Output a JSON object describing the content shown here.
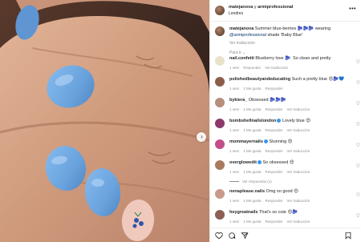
{
  "post": {
    "owner": "matejanova",
    "separator": " y ",
    "coauthor": "armiprofessional",
    "location": "Londres",
    "more_icon": "more-horizontal-icon"
  },
  "caption": {
    "username": "matejanova",
    "text_before": " Summer blue-berries 🫐🫐🫐 wearing ",
    "mention": "@armiprofessional",
    "text_after": " shade 'Baby Blue'",
    "see_translation": "Ver traducción"
  },
  "filter_label": "Para ti",
  "comments": [
    {
      "username": "nail.confetti",
      "verified": false,
      "text": " Blueberry love 🫐. So clean and pretty",
      "time": "1 sem",
      "likes": "",
      "reply": "Responder",
      "translate": "Ver traducción",
      "avatar_color": "#e9e2c9"
    },
    {
      "username": "polishedbeautyandeducating",
      "verified": false,
      "text": " Such a pretty blue 😍🫐💙",
      "time": "1 sem",
      "likes": "1 Me gusta",
      "reply": "Responder",
      "translate": "",
      "avatar_color": "#8b5e4a"
    },
    {
      "username": "bykiera_",
      "verified": false,
      "text": " Obsessed 🫐🫐🫐",
      "time": "1 sem",
      "likes": "1 Me gusta",
      "reply": "Responder",
      "translate": "Ver traducción",
      "avatar_color": "#b58f7c"
    },
    {
      "username": "bombshellnailslondon",
      "verified": true,
      "text": " Lovely blue 😍",
      "time": "1 sem",
      "likes": "1 Me gusta",
      "reply": "Responder",
      "translate": "Ver traducción",
      "avatar_color": "#8b3a6b"
    },
    {
      "username": "mommayernails",
      "verified": true,
      "text": " Stunning 😍",
      "time": "1 sem",
      "likes": "1 Me gusta",
      "reply": "Responder",
      "translate": "Ver traducción",
      "avatar_color": "#c24f8a"
    },
    {
      "username": "overglowedit",
      "verified": true,
      "text": " So obsessed 😍",
      "time": "1 sem",
      "likes": "1 Me gusta",
      "reply": "Responder",
      "translate": "Ver traducción",
      "avatar_color": "#a97a5d"
    },
    {
      "username": "nenaplease.nails",
      "verified": false,
      "text": " Omg so good 😍",
      "time": "1 sem",
      "likes": "1 Me gusta",
      "reply": "Responder",
      "translate": "Ver traducción",
      "avatar_color": "#c99a8a"
    },
    {
      "username": "heygreatnails",
      "verified": false,
      "text": " That's so cute 😍🫐",
      "time": "1 sem",
      "likes": "1 Me gusta",
      "reply": "Responder",
      "translate": "Ver traducción",
      "avatar_color": "#8c5e54"
    }
  ],
  "view_replies": "Ver respuestas (1)",
  "actions": {
    "like_icon": "heart-icon",
    "comment_icon": "comment-icon",
    "share_icon": "share-icon",
    "save_icon": "bookmark-icon",
    "next_icon": "chevron-right-icon",
    "comment_like_icon": "heart-icon"
  },
  "colors": {
    "nail_blue": "#6ea7e0",
    "skin": "#d3a184",
    "link": "#00376b",
    "meta": "#8e8e8e",
    "verified": "#3897f0"
  }
}
